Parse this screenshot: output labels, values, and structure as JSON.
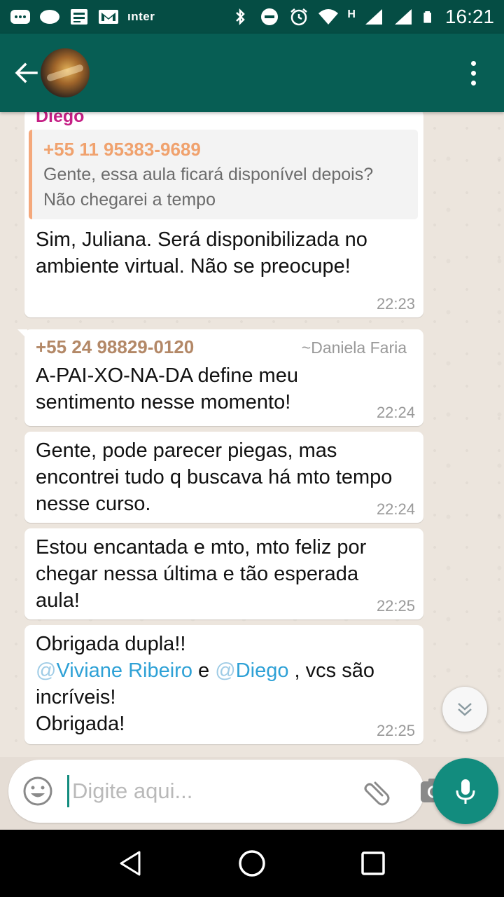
{
  "status_bar": {
    "carrier": "ınter",
    "network_type": "H",
    "time": "16:21"
  },
  "app_bar": {
    "back_icon": "arrow-left-icon",
    "menu_icon": "more-vert-icon"
  },
  "messages": [
    {
      "sender": "Diego",
      "quote": {
        "author": "+55 11 95383-9689",
        "text": "Gente, essa aula ficará disponível depois? Não chegarei a tempo"
      },
      "text": "Sim, Juliana. Será disponibilizada no ambiente virtual. Não se preocupe!",
      "time": "22:23"
    },
    {
      "phone": "+55 24 98829-0120",
      "push_name": "~Daniela Faria",
      "text": "A-PAI-XO-NA-DA define meu sentimento nesse momento!",
      "time": "22:24"
    },
    {
      "text": "Gente, pode parecer piegas, mas encontrei tudo q buscava há mto tempo nesse curso.",
      "time": "22:24"
    },
    {
      "text": "Estou encantada e mto, mto feliz por chegar nessa última e tão esperada aula!",
      "time": "22:25"
    },
    {
      "line1": "Obrigada dupla!!",
      "mention1_at": "@",
      "mention1": "Viviane Ribeiro",
      "connector": " e ",
      "mention2_at": "@",
      "mention2": "Diego",
      "rest": " , vcs são incríveis!",
      "line3": "Obrigada!",
      "time": "22:25"
    }
  ],
  "input": {
    "placeholder": "Digite aqui..."
  },
  "colors": {
    "header": "#075e54",
    "status_bar": "#054d44",
    "accent": "#128c7e",
    "sender_name": "#c51f85",
    "quote_author": "#f0a26e",
    "mention": "#2ea1d6"
  }
}
